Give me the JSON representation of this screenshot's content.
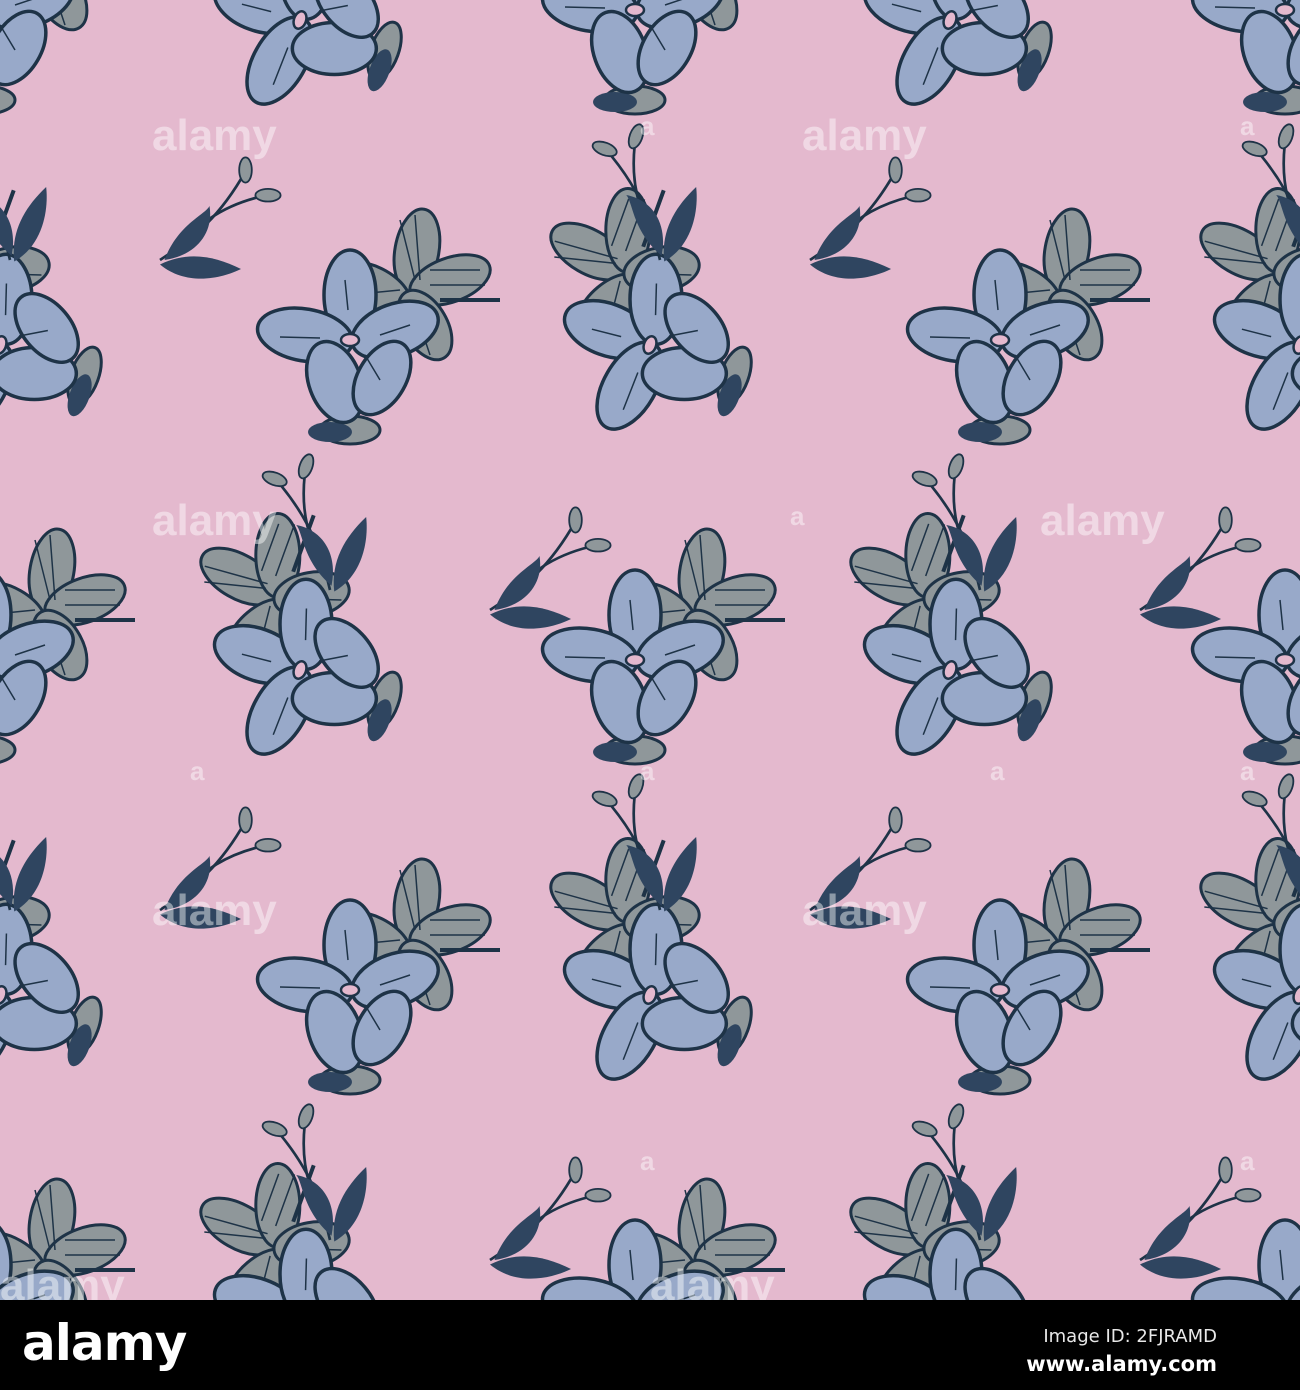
{
  "colors": {
    "background": "#e4b9ce",
    "petal_blue": "#98a9c9",
    "petal_gray": "#8f979a",
    "outline": "#1e3347",
    "leaf": "#2f4560"
  },
  "watermark": {
    "text": "alamy",
    "small": "a"
  },
  "footer": {
    "logo": "alamy",
    "image_id": "Image ID: 2FJRAMD",
    "website": "www.alamy.com"
  }
}
